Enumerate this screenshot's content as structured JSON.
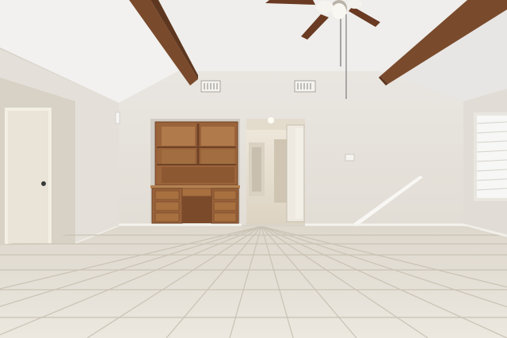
{
  "scene": {
    "kind": "empty living room interior with vaulted ceiling",
    "palette": {
      "ceiling": "#efeeec",
      "wall": "#e7e3dd",
      "wall_shadow": "#d9d4cc",
      "beam": "#7a4a2c",
      "wood": "#9a633a",
      "wood_dark": "#6e4226",
      "floor": "#e6e1d7",
      "floor_grout": "#c9c2b4",
      "door": "#ece8de",
      "window_light": "#f6f6f4",
      "fan_blade": "#6a3a22"
    },
    "icons": [
      "ceiling-fan-icon",
      "air-vent-icon",
      "light-switch-icon"
    ]
  }
}
